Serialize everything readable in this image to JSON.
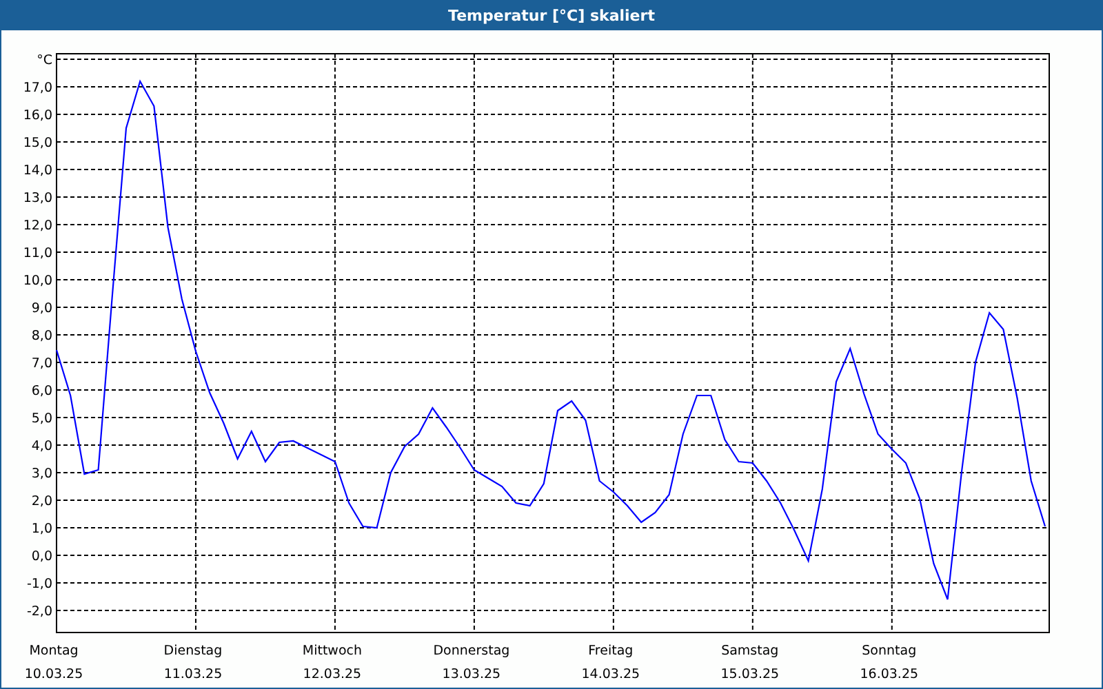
{
  "window": {
    "title": "Temperatur [°C] skaliert"
  },
  "chart_data": {
    "type": "line",
    "ylabel": "°C",
    "grid": true,
    "ylim": [
      -2.8,
      18.0
    ],
    "yticks": [
      {
        "value": -2,
        "label": "-2,0"
      },
      {
        "value": -1,
        "label": "-1,0"
      },
      {
        "value": 0,
        "label": "0,0"
      },
      {
        "value": 1,
        "label": "1,0"
      },
      {
        "value": 2,
        "label": "2,0"
      },
      {
        "value": 3,
        "label": "3,0"
      },
      {
        "value": 4,
        "label": "4,0"
      },
      {
        "value": 5,
        "label": "5,0"
      },
      {
        "value": 6,
        "label": "6,0"
      },
      {
        "value": 7,
        "label": "7,0"
      },
      {
        "value": 8,
        "label": "8,0"
      },
      {
        "value": 9,
        "label": "9,0"
      },
      {
        "value": 10,
        "label": "10,0"
      },
      {
        "value": 11,
        "label": "11,0"
      },
      {
        "value": 12,
        "label": "12,0"
      },
      {
        "value": 13,
        "label": "13,0"
      },
      {
        "value": 14,
        "label": "14,0"
      },
      {
        "value": 15,
        "label": "15,0"
      },
      {
        "value": 16,
        "label": "16,0"
      },
      {
        "value": 17,
        "label": "17,0"
      }
    ],
    "categories": [
      "Montag",
      null,
      null,
      null,
      null,
      null,
      null,
      null,
      null,
      null,
      "Dienstag",
      null,
      null,
      null,
      null,
      null,
      null,
      null,
      null,
      null,
      "Mittwoch",
      null,
      null,
      null,
      null,
      null,
      null,
      null,
      null,
      null,
      "Donnerstag",
      null,
      null,
      null,
      null,
      null,
      null,
      null,
      null,
      null,
      "Freitag",
      null,
      null,
      null,
      null,
      null,
      null,
      null,
      null,
      null,
      "Samstag",
      null,
      null,
      null,
      null,
      null,
      null,
      null,
      null,
      null,
      "Sonntag",
      null,
      null,
      null,
      null,
      null,
      null,
      null,
      null,
      null,
      null,
      null
    ],
    "annotations": [
      "10.03.25",
      "11.03.25",
      "12.03.25",
      "13.03.25",
      "14.03.25",
      "15.03.25",
      "16.03.25"
    ],
    "series": [
      {
        "color": "#0000ff",
        "values": [
          7.45,
          5.8,
          2.95,
          3.1,
          9.4,
          15.5,
          17.2,
          16.3,
          11.9,
          9.3,
          7.4,
          5.9,
          4.8,
          3.5,
          4.5,
          3.4,
          4.1,
          4.15,
          3.9,
          3.65,
          3.4,
          1.9,
          1.05,
          1.0,
          3.0,
          3.95,
          4.4,
          5.35,
          4.65,
          3.9,
          3.1,
          2.8,
          2.5,
          1.9,
          1.8,
          2.6,
          5.25,
          5.6,
          4.9,
          2.7,
          2.3,
          1.8,
          1.2,
          1.55,
          2.2,
          4.4,
          5.8,
          5.8,
          4.2,
          3.4,
          3.35,
          2.7,
          1.9,
          0.9,
          -0.2,
          2.4,
          6.3,
          7.5,
          5.85,
          4.4,
          3.85,
          3.35,
          2.05,
          -0.3,
          -1.6,
          3.0,
          7.0,
          8.8,
          8.2,
          5.7,
          2.7,
          1.05
        ]
      }
    ]
  }
}
